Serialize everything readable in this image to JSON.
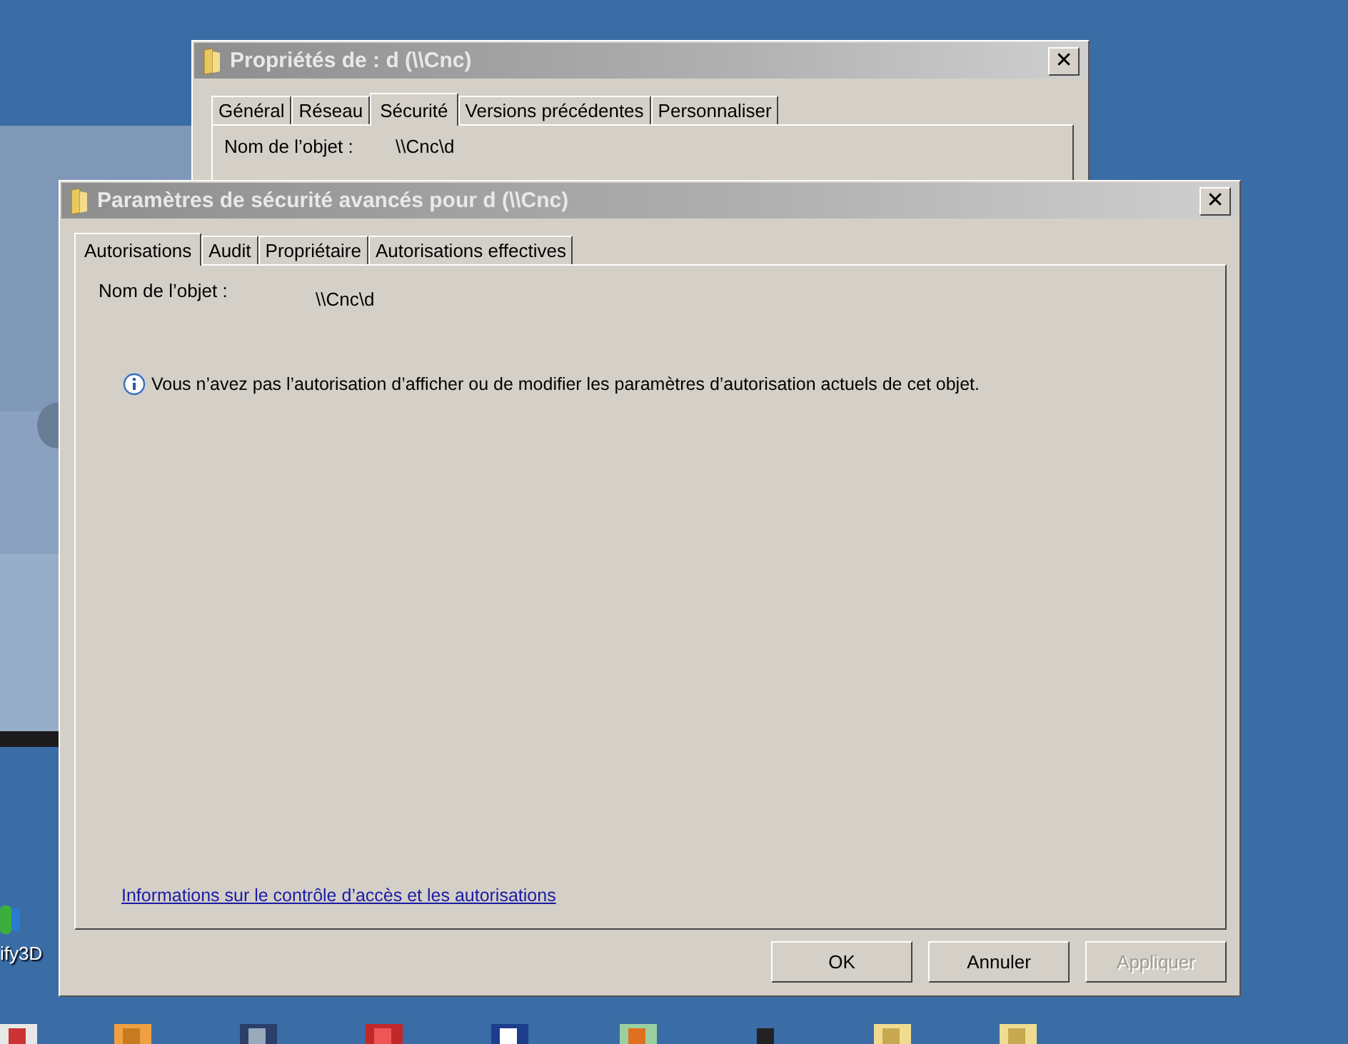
{
  "desktop": {
    "icon_label": "ify3D"
  },
  "back_window": {
    "title": "Propriétés de : d (\\\\Cnc)",
    "close": "✕",
    "tabs": [
      {
        "label": "Général",
        "selected": false
      },
      {
        "label": "Réseau",
        "selected": false
      },
      {
        "label": "Sécurité",
        "selected": true
      },
      {
        "label": "Versions précédentes",
        "selected": false
      },
      {
        "label": "Personnaliser",
        "selected": false
      }
    ],
    "object_label": "Nom de l’objet :",
    "object_value": "\\\\Cnc\\d"
  },
  "front_window": {
    "title": "Paramètres de sécurité avancés pour d (\\\\Cnc)",
    "close": "✕",
    "tabs": [
      {
        "label": "Autorisations",
        "selected": true
      },
      {
        "label": "Audit",
        "selected": false
      },
      {
        "label": "Propriétaire",
        "selected": false
      },
      {
        "label": "Autorisations effectives",
        "selected": false
      }
    ],
    "object_label": "Nom de l’objet :",
    "object_value": "\\\\Cnc\\d",
    "info_message": "Vous n’avez pas l’autorisation d’afficher ou de modifier les paramètres d’autorisation actuels de cet objet.",
    "help_link": "Informations sur le contrôle d’accès et les autorisations",
    "buttons": [
      {
        "label": "OK",
        "disabled": false
      },
      {
        "label": "Annuler",
        "disabled": false
      },
      {
        "label": "Appliquer",
        "disabled": true
      }
    ]
  }
}
